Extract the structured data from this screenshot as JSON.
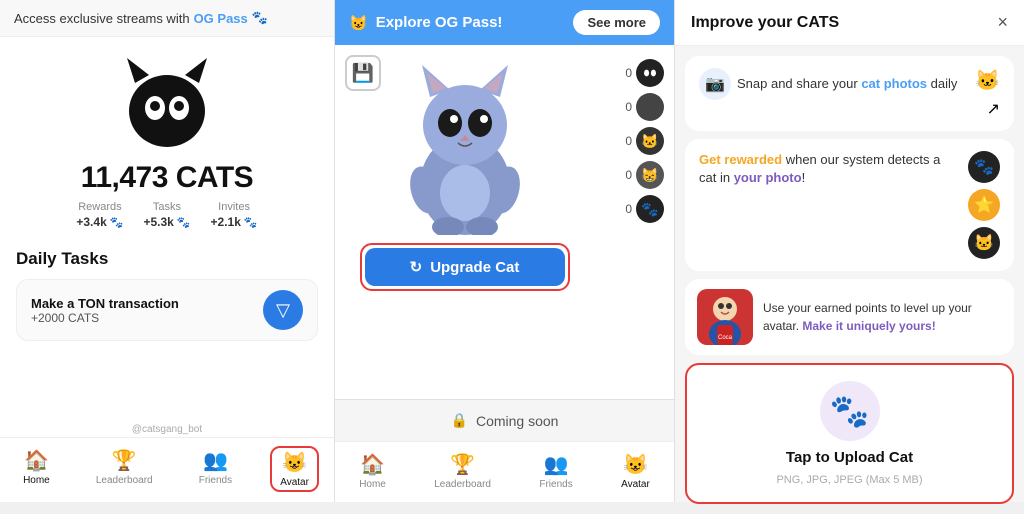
{
  "left": {
    "og_banner": "Access exclusive streams with ",
    "og_link": "OG Pass",
    "cats_count": "11,473 CATS",
    "stats": [
      {
        "label": "Rewards",
        "value": "+3.4k"
      },
      {
        "label": "Tasks",
        "value": "+5.3k"
      },
      {
        "label": "Invites",
        "value": "+2.1k"
      }
    ],
    "daily_tasks_label": "Daily Tasks",
    "task": {
      "title": "Make a TON transaction",
      "reward": "+2000 CATS"
    },
    "nav": [
      {
        "label": "Home",
        "icon": "🏠",
        "active": true
      },
      {
        "label": "Leaderboard",
        "icon": "🏆",
        "active": false
      },
      {
        "label": "Friends",
        "icon": "👥",
        "active": false
      },
      {
        "label": "Avatar",
        "icon": "😺",
        "active": false,
        "highlighted": true
      }
    ],
    "account": "@catsgang_bot"
  },
  "mid": {
    "header_title": "Explore OG Pass!",
    "see_more": "See more",
    "cat_items": [
      {
        "count": "0"
      },
      {
        "count": "0"
      },
      {
        "count": "0"
      },
      {
        "count": "0"
      },
      {
        "count": "0"
      }
    ],
    "upgrade_btn": "Upgrade Cat",
    "coming_soon": "Coming soon",
    "nav": [
      {
        "label": "Home",
        "icon": "🏠"
      },
      {
        "label": "Leaderboard",
        "icon": "🏆"
      },
      {
        "label": "Friends",
        "icon": "👥"
      },
      {
        "label": "Avatar",
        "icon": "😺"
      }
    ]
  },
  "right": {
    "title": "Improve your CATS",
    "close": "×",
    "card1": {
      "line1": "Snap and share your ",
      "highlight1": "cat photos",
      "line2": " daily"
    },
    "card2": {
      "highlight1": "Get rewarded",
      "line1": " when our system detects a cat in ",
      "highlight2": "your photo",
      "line2": "!"
    },
    "card3": {
      "line1": "Use your earned points to level up your avatar. ",
      "highlight": "Make it uniquely yours!"
    },
    "upload_title": "Tap to Upload Cat",
    "upload_sub": "PNG, JPG, JPEG (Max 5 MB)"
  }
}
